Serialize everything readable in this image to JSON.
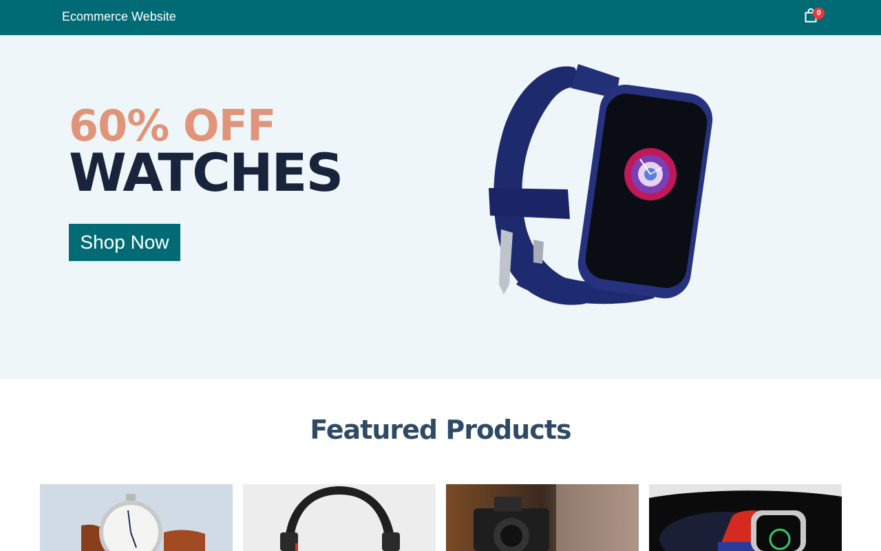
{
  "navbar": {
    "brand": "Ecommerce Website",
    "cart_icon": "shopping-bag-icon",
    "cart_count": "0"
  },
  "hero": {
    "discount": "60% OFF",
    "product": "WATCHES",
    "cta_label": "Shop Now",
    "image": "smartwatch-image"
  },
  "featured": {
    "title": "Featured Products",
    "products": [
      {
        "image": "analog-watch-image"
      },
      {
        "image": "headphones-image"
      },
      {
        "image": "camera-image"
      },
      {
        "image": "smartwatch-red-image"
      }
    ]
  },
  "colors": {
    "brand": "#016b75",
    "accent": "#e0957a",
    "heading": "#18243b",
    "badge": "#e63a3a",
    "hero_bg": "#eef6f9"
  }
}
